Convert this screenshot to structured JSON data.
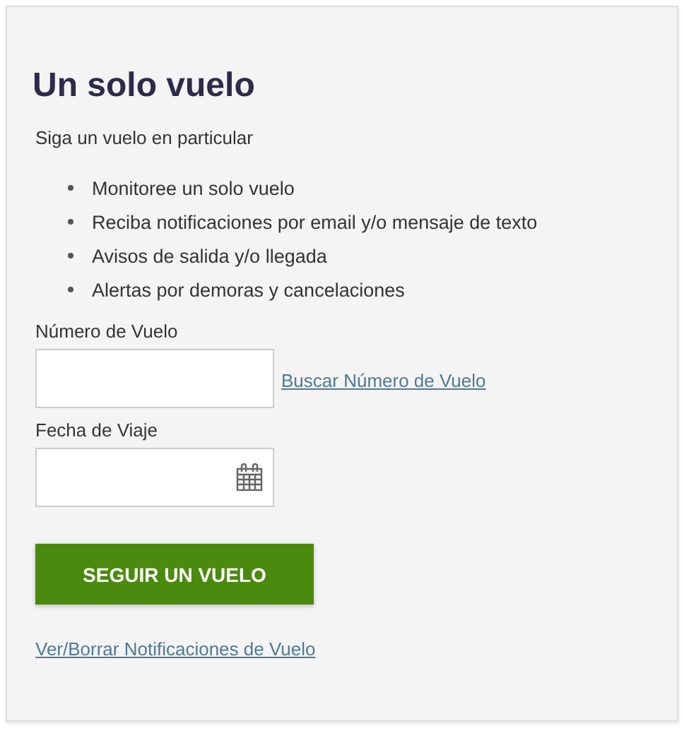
{
  "title": "Un solo vuelo",
  "intro": "Siga un vuelo en particular",
  "features": [
    "Monitoree un solo vuelo",
    "Reciba notificaciones por email y/o mensaje de texto",
    "Avisos de salida y/o llegada",
    "Alertas por demoras y cancelaciones"
  ],
  "fields": [
    {
      "kind": "text",
      "label": "Número de Vuelo",
      "link": "Buscar Número de Vuelo"
    },
    {
      "kind": "date",
      "label": "Fecha de Viaje"
    }
  ],
  "submit_button": "SEGUIR UN VUELO",
  "footer_link": "Ver/Borrar Notificaciones de Vuelo"
}
